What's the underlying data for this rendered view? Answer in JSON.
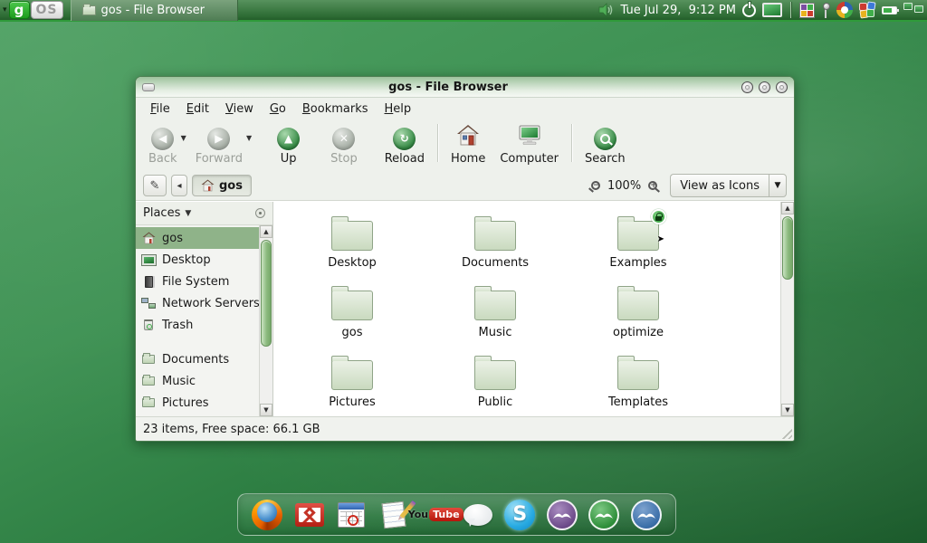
{
  "panel": {
    "logo": {
      "g": "g",
      "os": "OS"
    },
    "taskbar_label": "gos - File Browser",
    "clock": "Tue Jul 29,  9:12 PM",
    "tray_icons": [
      "volume-icon",
      "power-icon",
      "display-icon",
      "photo-grid-icon",
      "antenna-icon",
      "swirl-icon",
      "apps-cluster-icon",
      "battery-icon",
      "network-computers-icon"
    ]
  },
  "window": {
    "title": "gos - File Browser",
    "menu": [
      "File",
      "Edit",
      "View",
      "Go",
      "Bookmarks",
      "Help"
    ],
    "toolbar": {
      "back": "Back",
      "forward": "Forward",
      "up": "Up",
      "stop": "Stop",
      "reload": "Reload",
      "home": "Home",
      "computer": "Computer",
      "search": "Search"
    },
    "location": {
      "path": "gos",
      "zoom": "100%",
      "view_mode": "View as Icons"
    },
    "places": {
      "header": "Places",
      "items": [
        "gos",
        "Desktop",
        "File System",
        "Network Servers",
        "Trash",
        "Documents",
        "Music",
        "Pictures"
      ],
      "selected": "gos"
    },
    "files": [
      {
        "name": "Desktop"
      },
      {
        "name": "Documents"
      },
      {
        "name": "Examples",
        "emblems": [
          "read-only-lock",
          "symlink-arrow"
        ]
      },
      {
        "name": "gos"
      },
      {
        "name": "Music"
      },
      {
        "name": "optimize"
      },
      {
        "name": "Pictures"
      },
      {
        "name": "Public"
      },
      {
        "name": "Templates"
      }
    ],
    "status": "23 items, Free space: 66.1 GB"
  },
  "dock": {
    "items": [
      "firefox",
      "gmail",
      "calendar",
      "docs",
      "youtube",
      "chat-bubble",
      "skype",
      "openoffice-impress",
      "openoffice-calc",
      "openoffice-writer"
    ]
  },
  "colors": {
    "accent_green": "#2f9a3a",
    "selection": "#8fb389",
    "wallpaper_dark": "#1b5a2b"
  }
}
